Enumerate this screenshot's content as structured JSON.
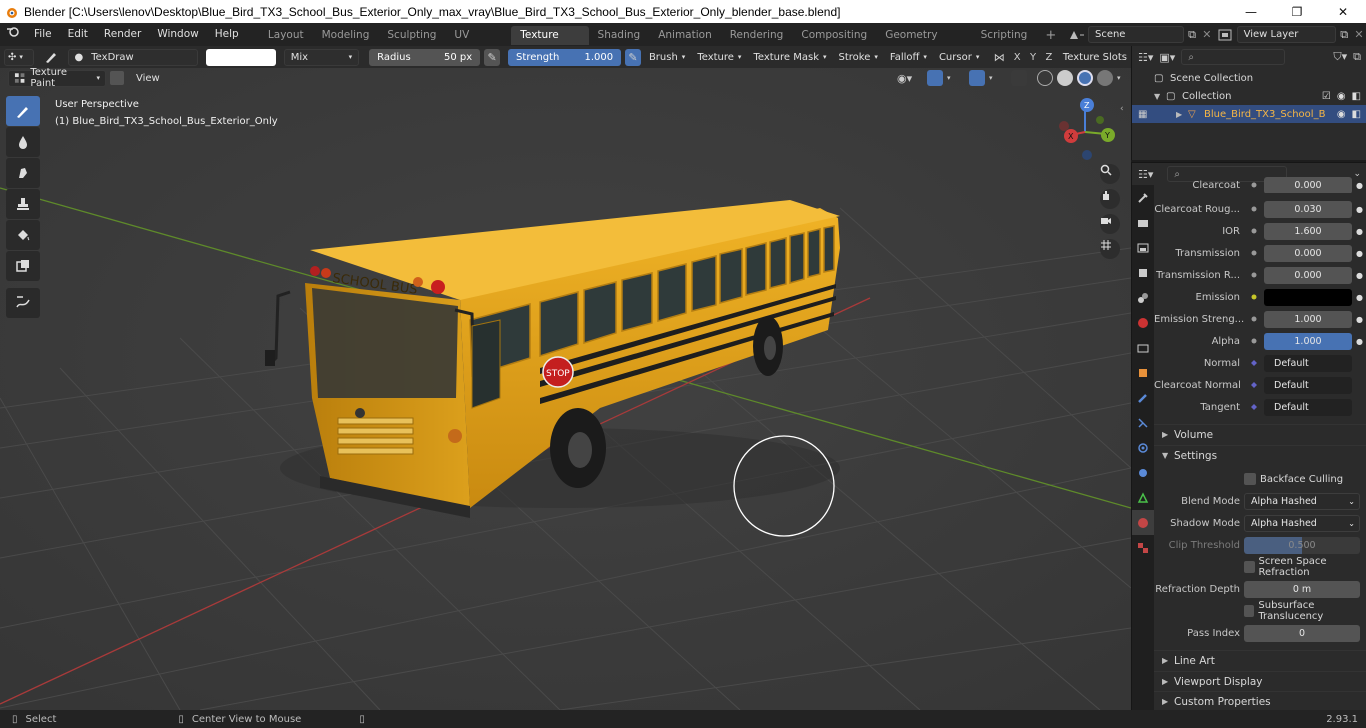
{
  "window": {
    "title": "Blender [C:\\Users\\lenov\\Desktop\\Blue_Bird_TX3_School_Bus_Exterior_Only_max_vray\\Blue_Bird_TX3_School_Bus_Exterior_Only_blender_base.blend]",
    "minimize": "—",
    "maximize": "❐",
    "close": "✕"
  },
  "menu": [
    "File",
    "Edit",
    "Render",
    "Window",
    "Help"
  ],
  "workspaces": [
    {
      "label": "Layout",
      "active": false
    },
    {
      "label": "Modeling",
      "active": false
    },
    {
      "label": "Sculpting",
      "active": false
    },
    {
      "label": "UV Editing",
      "active": false
    },
    {
      "label": "Texture Paint",
      "active": true
    },
    {
      "label": "Shading",
      "active": false
    },
    {
      "label": "Animation",
      "active": false
    },
    {
      "label": "Rendering",
      "active": false
    },
    {
      "label": "Compositing",
      "active": false
    },
    {
      "label": "Geometry Nodes",
      "active": false
    },
    {
      "label": "Scripting",
      "active": false
    }
  ],
  "add_tab": "+",
  "scene": {
    "label": "Scene"
  },
  "view_layer": {
    "label": "View Layer"
  },
  "tool_header": {
    "brush_name": "TexDraw",
    "blend": "Mix",
    "radius_label": "Radius",
    "radius_value": "50 px",
    "strength_label": "Strength",
    "strength_value": "1.000",
    "menus": [
      "Brush",
      "Texture",
      "Texture Mask",
      "Stroke",
      "Falloff",
      "Cursor"
    ],
    "axes": [
      "X",
      "Y",
      "Z"
    ],
    "texture_slots": "Texture Slots"
  },
  "viewport_header": {
    "mode": "Texture Paint",
    "view": "View"
  },
  "viewport": {
    "perspective": "User Perspective",
    "object_info": "(1) Blue_Bird_TX3_School_Bus_Exterior_Only",
    "bus_sign": "SCHOOL BUS",
    "stop_sign": "STOP",
    "gizmo": {
      "x": "X",
      "y": "Y",
      "z": "Z"
    }
  },
  "outliner": {
    "scene_collection": "Scene Collection",
    "collection": "Collection",
    "object": "Blue_Bird_TX3_School_B"
  },
  "properties": {
    "rows": [
      {
        "label": "Clearcoat",
        "value": "0.000",
        "style": "grey",
        "partial": true
      },
      {
        "label": "Clearcoat Roug...",
        "value": "0.030",
        "style": "grey"
      },
      {
        "label": "IOR",
        "value": "1.600",
        "style": "grey"
      },
      {
        "label": "Transmission",
        "value": "0.000",
        "style": "grey"
      },
      {
        "label": "Transmission R...",
        "value": "0.000",
        "style": "grey"
      },
      {
        "label": "Emission",
        "value": "",
        "style": "black"
      },
      {
        "label": "Emission Streng...",
        "value": "1.000",
        "style": "grey"
      },
      {
        "label": "Alpha",
        "value": "1.000",
        "style": "blue"
      },
      {
        "label": "Normal",
        "value": "Default",
        "style": "dark"
      },
      {
        "label": "Clearcoat Normal",
        "value": "Default",
        "style": "dark"
      },
      {
        "label": "Tangent",
        "value": "Default",
        "style": "dark"
      }
    ],
    "volume": "Volume",
    "settings": "Settings",
    "backface_culling": "Backface Culling",
    "blend_mode_label": "Blend Mode",
    "blend_mode_value": "Alpha Hashed",
    "shadow_mode_label": "Shadow Mode",
    "shadow_mode_value": "Alpha Hashed",
    "clip_threshold_label": "Clip Threshold",
    "clip_threshold_value": "0.500",
    "screen_space_refraction": "Screen Space Refraction",
    "refraction_depth_label": "Refraction Depth",
    "refraction_depth_value": "0 m",
    "subsurface_translucency": "Subsurface Translucency",
    "pass_index_label": "Pass Index",
    "pass_index_value": "0",
    "line_art": "Line Art",
    "viewport_display": "Viewport Display",
    "custom_properties": "Custom Properties"
  },
  "status": {
    "select": "Select",
    "center_view": "Center View to Mouse",
    "version": "2.93.1"
  },
  "colors": {
    "accent": "#4772b3",
    "bus_yellow": "#e5a317",
    "viewport_bg": "#3d3d3d"
  }
}
